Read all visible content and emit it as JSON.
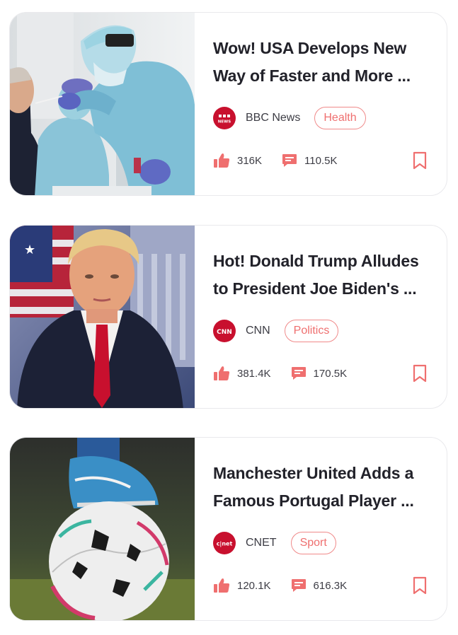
{
  "colors": {
    "accent": "#EF6F6F",
    "logo_red": "#C8102E",
    "title_text": "#22222A",
    "meta_text": "#3D3D45"
  },
  "articles": [
    {
      "title_line1": "Wow! USA Develops New",
      "title_line2": "Way of Faster and More ...",
      "source": "BBC News",
      "source_logo_text": "NEWS",
      "category": "Health",
      "likes": "316K",
      "comments": "110.5K",
      "image": "covid-test-photo"
    },
    {
      "title_line1": "Hot! Donald Trump Alludes",
      "title_line2": "to President Joe Biden's ...",
      "source": "CNN",
      "source_logo_text": "CNN",
      "category": "Politics",
      "likes": "381.4K",
      "comments": "170.5K",
      "image": "trump-portrait-photo"
    },
    {
      "title_line1": "Manchester United Adds a",
      "title_line2": "Famous Portugal Player ...",
      "source": "CNET",
      "source_logo_text": "c|net",
      "category": "Sport",
      "likes": "120.1K",
      "comments": "616.3K",
      "image": "soccer-ball-photo"
    }
  ],
  "icons": {
    "like": "thumbs-up-icon",
    "comment": "comment-icon",
    "bookmark": "bookmark-icon"
  }
}
